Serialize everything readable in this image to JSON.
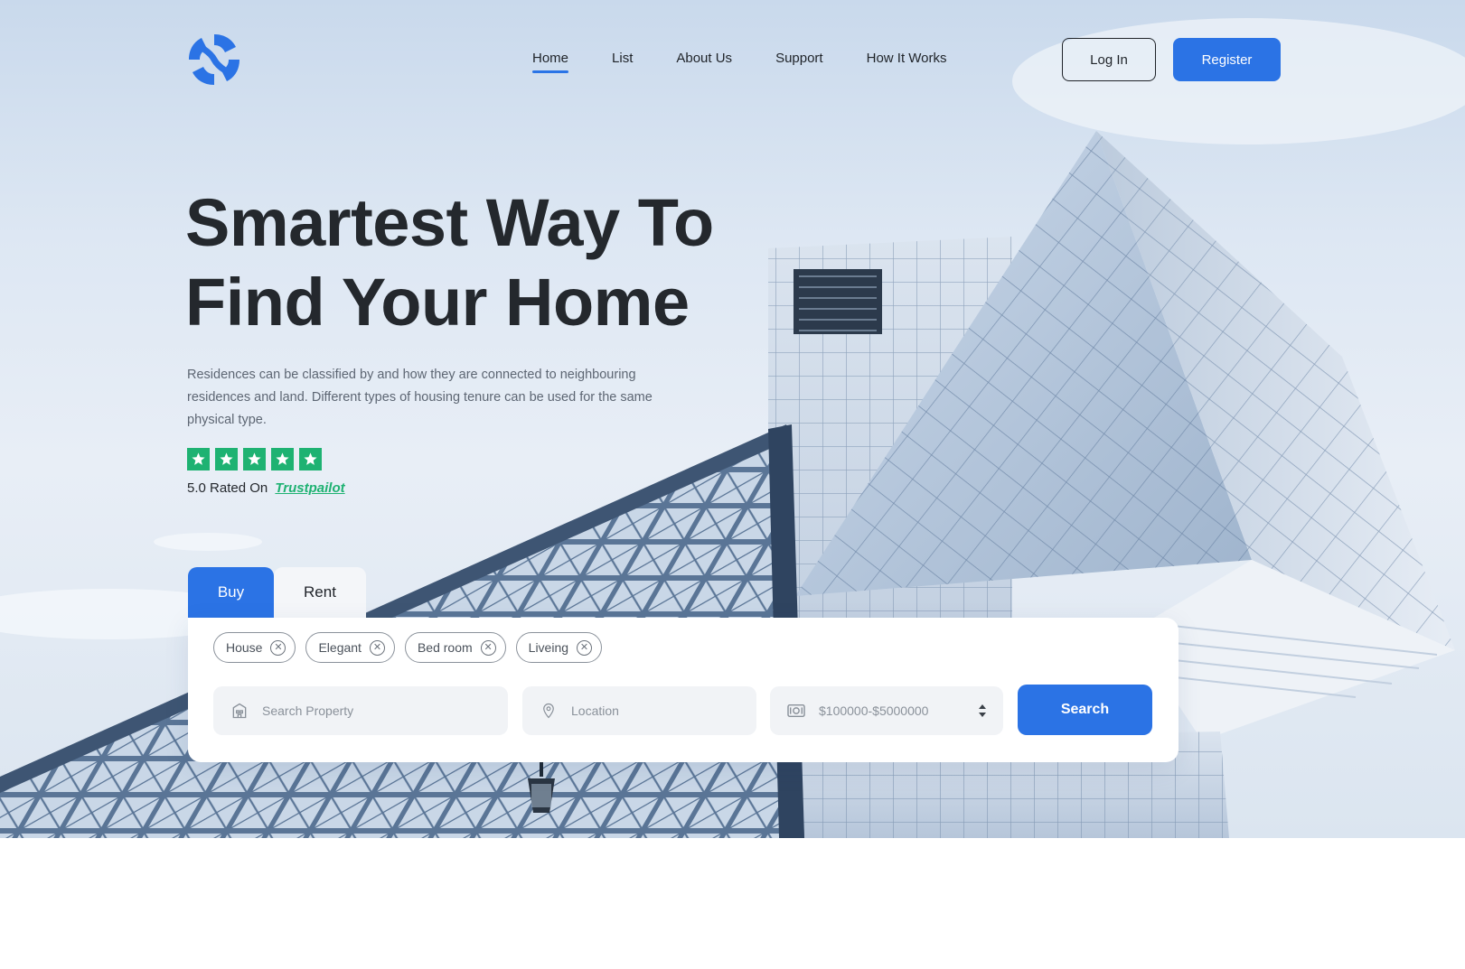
{
  "brand": {
    "logo_icon": "swirl-logo-icon",
    "accent": "#2b73e5"
  },
  "nav": {
    "items": [
      {
        "label": "Home",
        "active": true
      },
      {
        "label": "List",
        "active": false
      },
      {
        "label": "About Us",
        "active": false
      },
      {
        "label": "Support",
        "active": false
      },
      {
        "label": "How It Works",
        "active": false
      }
    ],
    "login_label": "Log In",
    "register_label": "Register"
  },
  "hero": {
    "title_line1": "Smartest Way To",
    "title_line2": "Find Your Home",
    "description": "Residences can be classified by and how they are connected to neighbouring residences and land. Different types of housing tenure can be used for the same physical type.",
    "stars": 5,
    "star_color": "#1eb272",
    "rating_text": "5.0 Rated On",
    "rating_link": "Trustpailot"
  },
  "search": {
    "tabs": [
      {
        "label": "Buy",
        "active": true
      },
      {
        "label": "Rent",
        "active": false
      }
    ],
    "chips": [
      "House",
      "Elegant",
      "Bed room",
      "Liveing"
    ],
    "property_placeholder": "Search Property",
    "location_placeholder": "Location",
    "price_range": "$100000-$5000000",
    "search_label": "Search"
  }
}
